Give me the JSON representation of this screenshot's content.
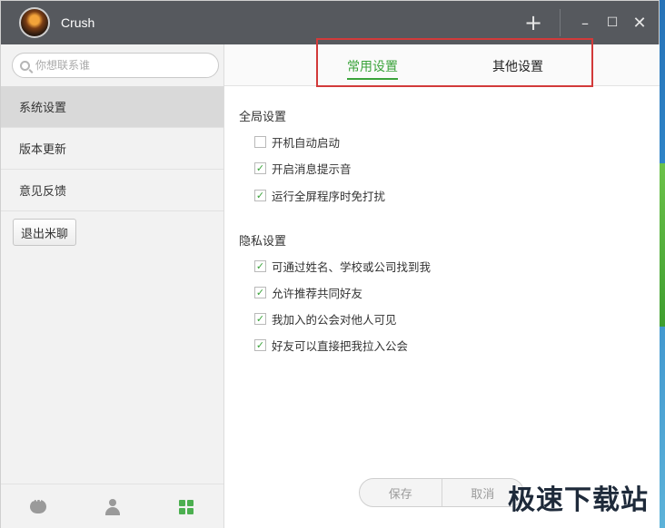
{
  "window": {
    "title": "Crush"
  },
  "titlebar": {
    "add_icon": "plus-icon",
    "minimize": "–",
    "maximize": "☐",
    "close": "✕"
  },
  "sidebar": {
    "search_placeholder": "你想联系谁",
    "items": [
      {
        "label": "系统设置",
        "active": true
      },
      {
        "label": "版本更新",
        "active": false
      },
      {
        "label": "意见反馈",
        "active": false
      }
    ],
    "logout_label": "退出米聊",
    "bottom_icons": [
      "chat-icon",
      "contacts-icon",
      "apps-icon"
    ]
  },
  "tabs": [
    {
      "label": "常用设置",
      "active": true
    },
    {
      "label": "其他设置",
      "active": false
    }
  ],
  "global": {
    "title": "全局设置",
    "options": [
      {
        "label": "开机自动启动",
        "checked": false
      },
      {
        "label": "开启消息提示音",
        "checked": true
      },
      {
        "label": "运行全屏程序时免打扰",
        "checked": true
      }
    ]
  },
  "privacy": {
    "title": "隐私设置",
    "options": [
      {
        "label": "可通过姓名、学校或公司找到我",
        "checked": true
      },
      {
        "label": "允许推荐共同好友",
        "checked": true
      },
      {
        "label": "我加入的公会对他人可见",
        "checked": true
      },
      {
        "label": "好友可以直接把我拉入公会",
        "checked": true
      }
    ]
  },
  "buttons": {
    "save": "保存",
    "cancel": "取消"
  },
  "watermark": "极速下载站",
  "colors": {
    "accent": "#3aa33a",
    "titlebar": "#56595e",
    "highlight": "#d23a3a"
  }
}
